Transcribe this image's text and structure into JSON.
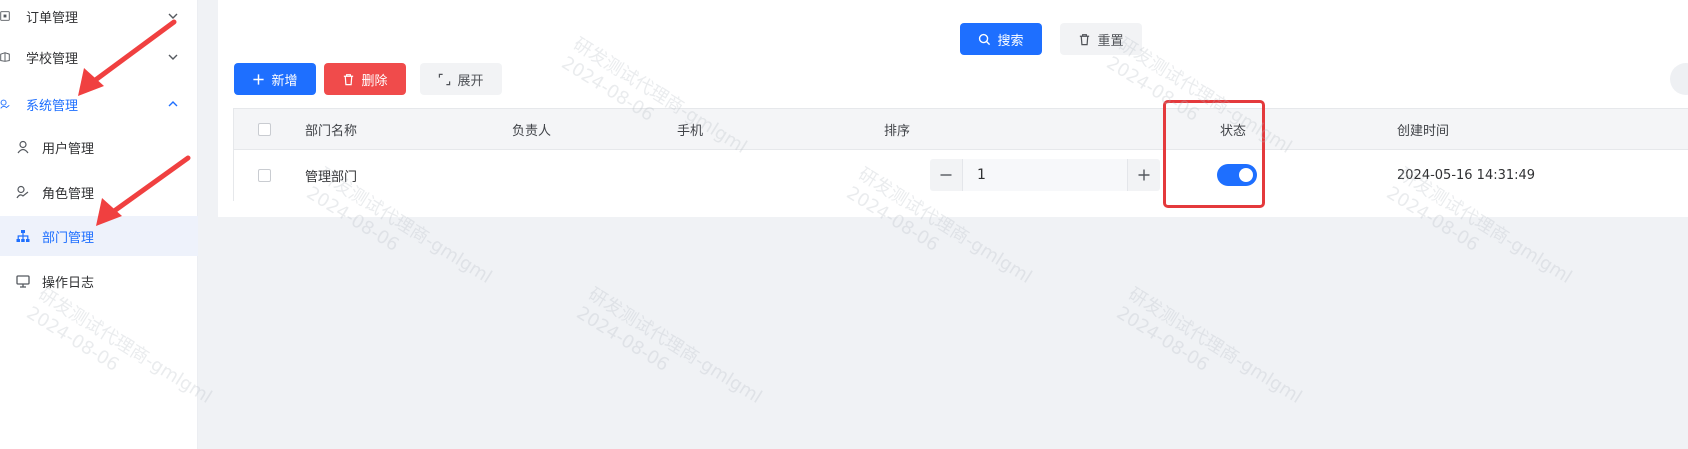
{
  "sidebar": {
    "items": [
      {
        "label": "订单管理",
        "icon": "order-icon",
        "expanded": false
      },
      {
        "label": "学校管理",
        "icon": "school-icon",
        "expanded": false
      },
      {
        "label": "系统管理",
        "icon": "system-icon",
        "expanded": true
      },
      {
        "label": "用户管理",
        "icon": "user-icon"
      },
      {
        "label": "角色管理",
        "icon": "role-icon"
      },
      {
        "label": "部门管理",
        "icon": "org-tree-icon",
        "active": true
      },
      {
        "label": "操作日志",
        "icon": "monitor-icon"
      }
    ]
  },
  "toolbar": {
    "search_label": "搜索",
    "reset_label": "重置",
    "add_label": "新增",
    "delete_label": "删除",
    "expand_label": "展开"
  },
  "table": {
    "columns": [
      "部门名称",
      "负责人",
      "手机",
      "排序",
      "状态",
      "创建时间"
    ],
    "rows": [
      {
        "name": "管理部门",
        "leader": "",
        "phone": "",
        "sort": "1",
        "status": true,
        "created": "2024-05-16 14:31:49"
      }
    ]
  },
  "watermark": {
    "line1": "研发测试代理商-gmlgml",
    "line2": "2024-08-06"
  },
  "colors": {
    "primary": "#1e6fff",
    "danger": "#f04b4b",
    "annotation": "#e4393c"
  }
}
